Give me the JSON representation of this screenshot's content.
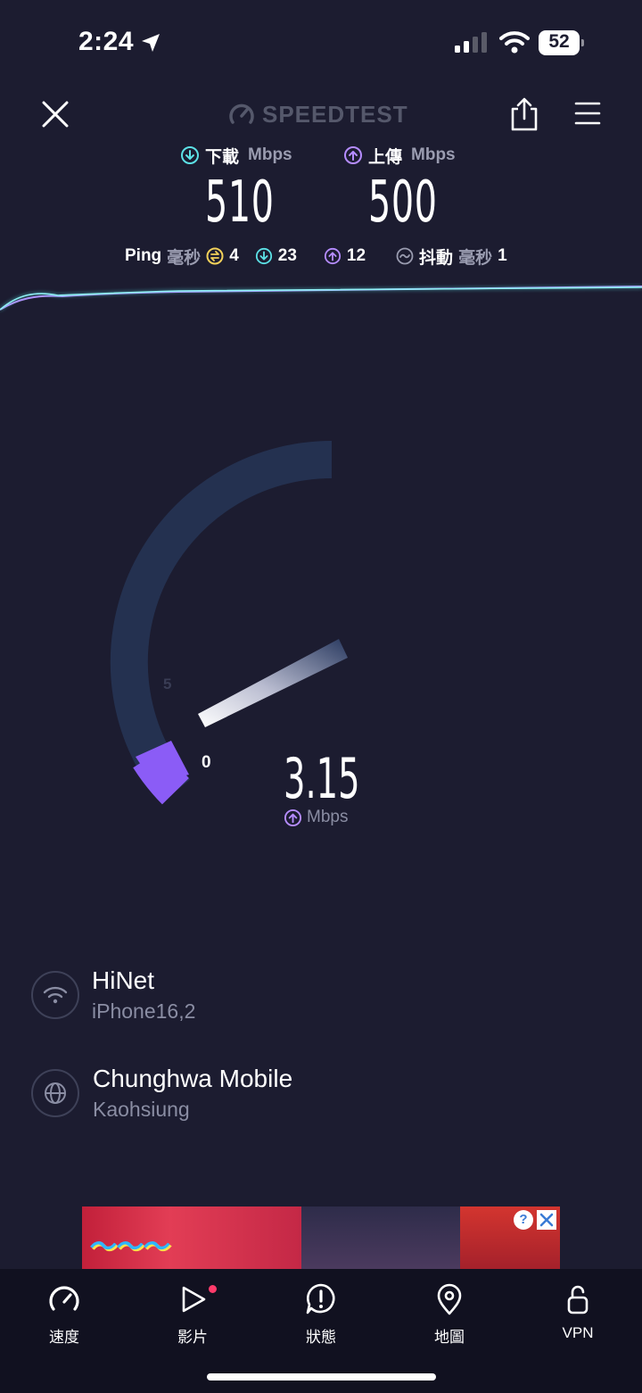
{
  "status_bar": {
    "time": "2:24",
    "battery": "52"
  },
  "header": {
    "brand": "SPEEDTEST"
  },
  "results": {
    "download_label": "下載",
    "upload_label": "上傳",
    "unit": "Mbps",
    "download_value": "510",
    "upload_value": "500"
  },
  "ping": {
    "label": "Ping",
    "unit": "毫秒",
    "idle": "4",
    "download": "23",
    "upload": "12",
    "jitter_label": "抖動",
    "jitter_unit": "毫秒",
    "jitter": "1"
  },
  "gauge": {
    "tick_zero": "0",
    "tick_five": "5",
    "current_value": "3.15",
    "unit": "Mbps",
    "direction": "upload"
  },
  "connection": {
    "isp_name": "HiNet",
    "device": "iPhone16,2",
    "server_name": "Chunghwa Mobile",
    "server_city": "Kaohsiung"
  },
  "tabs": [
    {
      "label": "速度",
      "icon": "speedometer-icon",
      "active": true
    },
    {
      "label": "影片",
      "icon": "play-icon",
      "badge": true
    },
    {
      "label": "狀態",
      "icon": "alert-icon"
    },
    {
      "label": "地圖",
      "icon": "map-pin-icon"
    },
    {
      "label": "VPN",
      "icon": "lock-icon"
    }
  ],
  "colors": {
    "background": "#1c1c30",
    "download_accent": "#5ce1e6",
    "upload_accent": "#b58cff",
    "gauge_track": "#243150",
    "gauge_fill": "#8b5cf6",
    "ping_idle": "#f2d15a"
  }
}
